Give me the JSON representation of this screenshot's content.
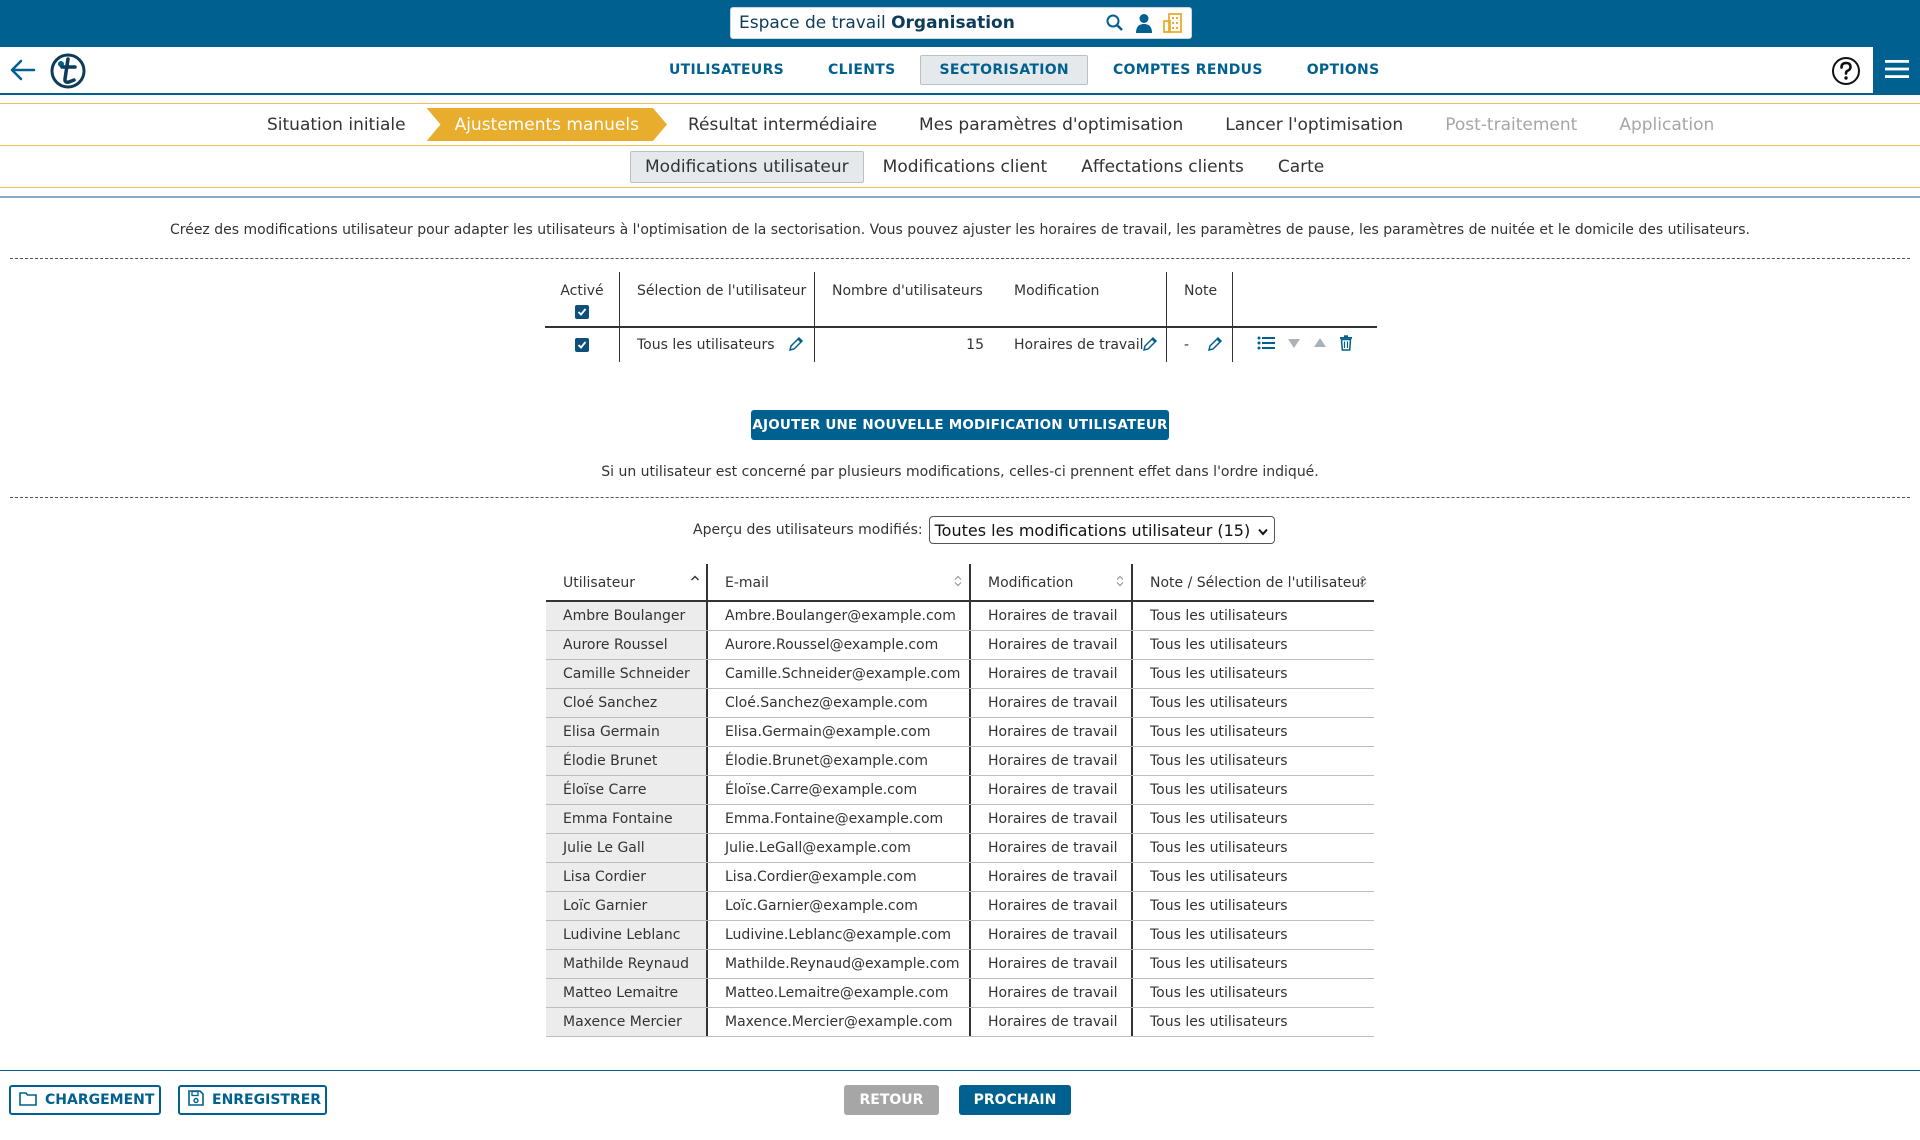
{
  "colors": {
    "brand": "#00608f",
    "accent": "#e9ad2d",
    "disabled": "#a6a6a6",
    "zebra": "#ececec"
  },
  "header": {
    "workspace_prefix": "Espace de travail",
    "workspace_name": "Organisation",
    "icons": [
      "search-icon",
      "user-icon",
      "building-icon"
    ]
  },
  "nav": {
    "items": [
      {
        "label": "UTILISATEURS",
        "active": false
      },
      {
        "label": "CLIENTS",
        "active": false
      },
      {
        "label": "SECTORISATION",
        "active": true
      },
      {
        "label": "COMPTES RENDUS",
        "active": false
      },
      {
        "label": "OPTIONS",
        "active": false
      }
    ]
  },
  "steps": [
    {
      "label": "Situation initiale",
      "state": "done"
    },
    {
      "label": "Ajustements manuels",
      "state": "active"
    },
    {
      "label": "Résultat intermédiaire",
      "state": "todo"
    },
    {
      "label": "Mes paramètres d'optimisation",
      "state": "todo"
    },
    {
      "label": "Lancer l'optimisation",
      "state": "todo"
    },
    {
      "label": "Post-traitement",
      "state": "disabled"
    },
    {
      "label": "Application",
      "state": "disabled"
    }
  ],
  "subtabs": [
    {
      "label": "Modifications utilisateur",
      "active": true
    },
    {
      "label": "Modifications client",
      "active": false
    },
    {
      "label": "Affectations clients",
      "active": false
    },
    {
      "label": "Carte",
      "active": false
    }
  ],
  "intro": "Créez des modifications utilisateur pour adapter les utilisateurs à l'optimisation de la sectorisation. Vous pouvez ajuster les horaires de travail, les paramètres de pause, les paramètres de nuitée et le domicile des utilisateurs.",
  "modifications": {
    "headers": {
      "active": "Activé",
      "selection": "Sélection de l'utilisateur",
      "count": "Nombre d'utilisateurs",
      "modification": "Modification",
      "note": "Note"
    },
    "rows": [
      {
        "active": true,
        "selection": "Tous les utilisateurs",
        "count": "15",
        "modification": "Horaires de travail",
        "note": "-"
      }
    ]
  },
  "add_button": "AJOUTER UNE NOUVELLE MODIFICATION UTILISATEUR",
  "order_note": "Si un utilisateur est concerné par plusieurs modifications, celles-ci prennent effet dans l'ordre indiqué.",
  "preview": {
    "label": "Aperçu des utilisateurs modifiés:",
    "selected": "Toutes les modifications utilisateur (15)"
  },
  "users_table": {
    "headers": [
      "Utilisateur",
      "E-mail",
      "Modification",
      "Note / Sélection de l'utilisateur"
    ],
    "rows": [
      [
        "Ambre Boulanger",
        "Ambre.Boulanger@example.com",
        "Horaires de travail",
        "Tous les utilisateurs"
      ],
      [
        "Aurore Roussel",
        "Aurore.Roussel@example.com",
        "Horaires de travail",
        "Tous les utilisateurs"
      ],
      [
        "Camille Schneider",
        "Camille.Schneider@example.com",
        "Horaires de travail",
        "Tous les utilisateurs"
      ],
      [
        "Cloé Sanchez",
        "Cloé.Sanchez@example.com",
        "Horaires de travail",
        "Tous les utilisateurs"
      ],
      [
        "Elisa Germain",
        "Elisa.Germain@example.com",
        "Horaires de travail",
        "Tous les utilisateurs"
      ],
      [
        "Élodie Brunet",
        "Élodie.Brunet@example.com",
        "Horaires de travail",
        "Tous les utilisateurs"
      ],
      [
        "Éloïse Carre",
        "Éloïse.Carre@example.com",
        "Horaires de travail",
        "Tous les utilisateurs"
      ],
      [
        "Emma Fontaine",
        "Emma.Fontaine@example.com",
        "Horaires de travail",
        "Tous les utilisateurs"
      ],
      [
        "Julie Le Gall",
        "Julie.LeGall@example.com",
        "Horaires de travail",
        "Tous les utilisateurs"
      ],
      [
        "Lisa Cordier",
        "Lisa.Cordier@example.com",
        "Horaires de travail",
        "Tous les utilisateurs"
      ],
      [
        "Loïc Garnier",
        "Loïc.Garnier@example.com",
        "Horaires de travail",
        "Tous les utilisateurs"
      ],
      [
        "Ludivine Leblanc",
        "Ludivine.Leblanc@example.com",
        "Horaires de travail",
        "Tous les utilisateurs"
      ],
      [
        "Mathilde Reynaud",
        "Mathilde.Reynaud@example.com",
        "Horaires de travail",
        "Tous les utilisateurs"
      ],
      [
        "Matteo Lemaitre",
        "Matteo.Lemaitre@example.com",
        "Horaires de travail",
        "Tous les utilisateurs"
      ],
      [
        "Maxence Mercier",
        "Maxence.Mercier@example.com",
        "Horaires de travail",
        "Tous les utilisateurs"
      ]
    ]
  },
  "footer": {
    "load": "CHARGEMENT",
    "save": "ENREGISTRER",
    "back": "RETOUR",
    "next": "PROCHAIN"
  }
}
